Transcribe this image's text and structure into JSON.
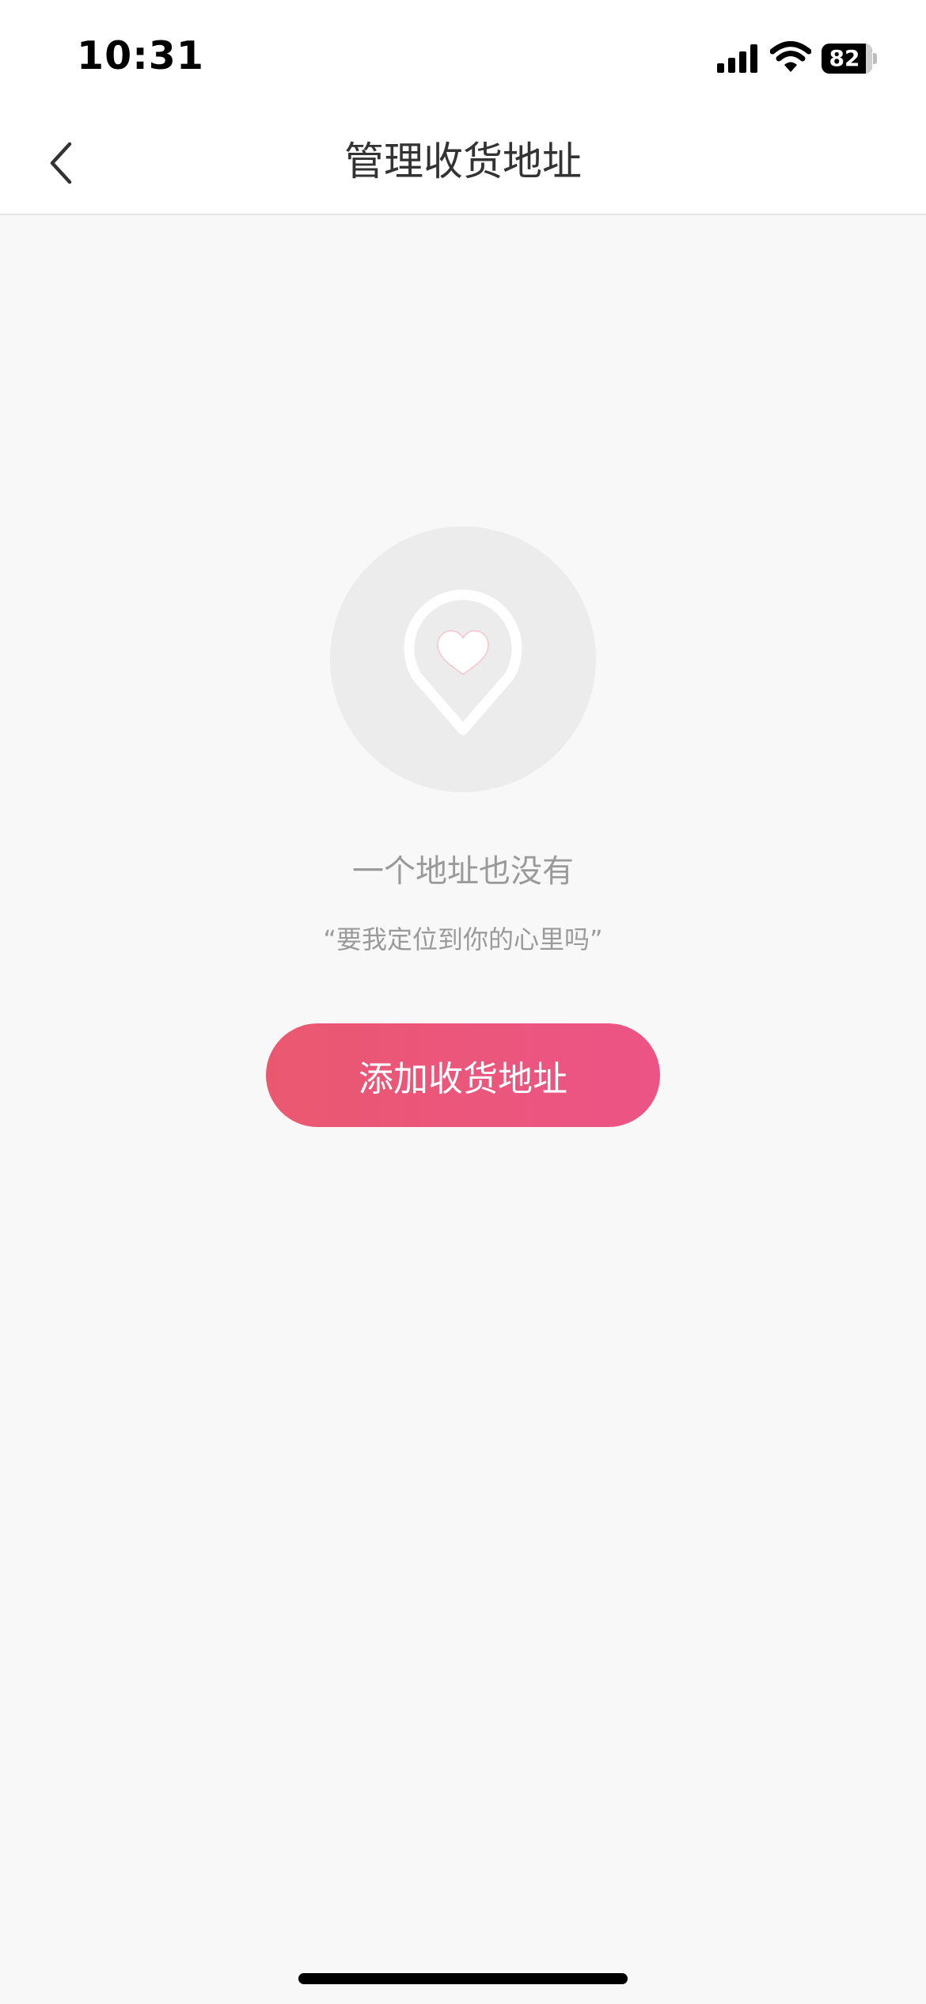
{
  "status_bar": {
    "time": "10:31",
    "battery_level": "82",
    "icons": [
      "signal-icon",
      "wifi-icon",
      "battery-icon"
    ]
  },
  "nav": {
    "back_icon": "chevron-left-icon",
    "title": "管理收货地址"
  },
  "empty_state": {
    "icon": "location-pin-heart-icon",
    "title": "一个地址也没有",
    "subtitle": "“要我定位到你的心里吗”"
  },
  "actions": {
    "add_address_label": "添加收货地址"
  },
  "colors": {
    "background": "#f8f8f8",
    "header_background": "#ffffff",
    "accent_start": "#ea5870",
    "accent_end": "#ec5486",
    "muted_text": "#9a9a9a",
    "title_text": "#333333"
  }
}
